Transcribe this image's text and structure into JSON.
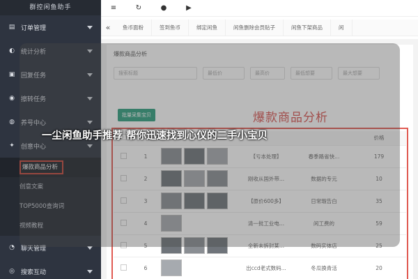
{
  "app": {
    "title": "群控闲鱼助手"
  },
  "sidebar": {
    "groups": [
      {
        "label": "订单管理",
        "icon": "document-icon"
      },
      {
        "label": "统计分析",
        "icon": "chart-icon"
      },
      {
        "label": "回复任务",
        "icon": "reply-icon"
      },
      {
        "label": "擦转任务",
        "icon": "task-icon"
      },
      {
        "label": "养号中心",
        "icon": "user-icon"
      },
      {
        "label": "创意中心",
        "icon": "bulb-icon"
      },
      {
        "label": "聊天管理",
        "icon": "chat-icon"
      },
      {
        "label": "搜索互动",
        "icon": "search-icon"
      }
    ],
    "subitems": [
      "爆款商品分析",
      "创意文案",
      "TOP5000查询词",
      "视频教程"
    ]
  },
  "topbar": {
    "icons": [
      "≡",
      "↻",
      "●",
      "▶"
    ]
  },
  "tabs": [
    "鱼币面粉",
    "签到鱼币",
    "绑定闲鱼",
    "闲鱼删除会员贴子",
    "闲鱼下架商品",
    "闲"
  ],
  "panel": {
    "title": "爆款商品分析",
    "filters": [
      "搜索标题",
      "最低价",
      "最高价",
      "最低想要",
      "最大想要"
    ],
    "batch_button": "批量采集宝贝",
    "headline_red": "爆款商品分析"
  },
  "table": {
    "headers": [
      "",
      "",
      "",
      "",
      "",
      "价格"
    ],
    "rows": [
      {
        "num": "1",
        "title": "【亏本处理】",
        "desc": "春季路省快...",
        "price": "179"
      },
      {
        "num": "2",
        "title": "刚收从国外带...",
        "desc": "数据的专元",
        "price": "10"
      },
      {
        "num": "3",
        "title": "【原价600多】",
        "desc": "日常瑕告白",
        "price": "35"
      },
      {
        "num": "4",
        "title": "清一批工业电...",
        "desc": "闲工费的",
        "price": "59"
      },
      {
        "num": "5",
        "title": "全新未拆封某...",
        "desc": "数码实体店",
        "price": "25"
      },
      {
        "num": "6",
        "title": "出ccd老式数码...",
        "desc": "冬瓜换青活",
        "price": "20"
      }
    ]
  },
  "overlay": {
    "headline": "一尘闲鱼助手推荐 帮你迅速找到心仪的二手小宝贝"
  },
  "colors": {
    "sidebar": "#2e3440",
    "accent_red": "#d9534f",
    "accent_green": "#2e9e7f"
  }
}
